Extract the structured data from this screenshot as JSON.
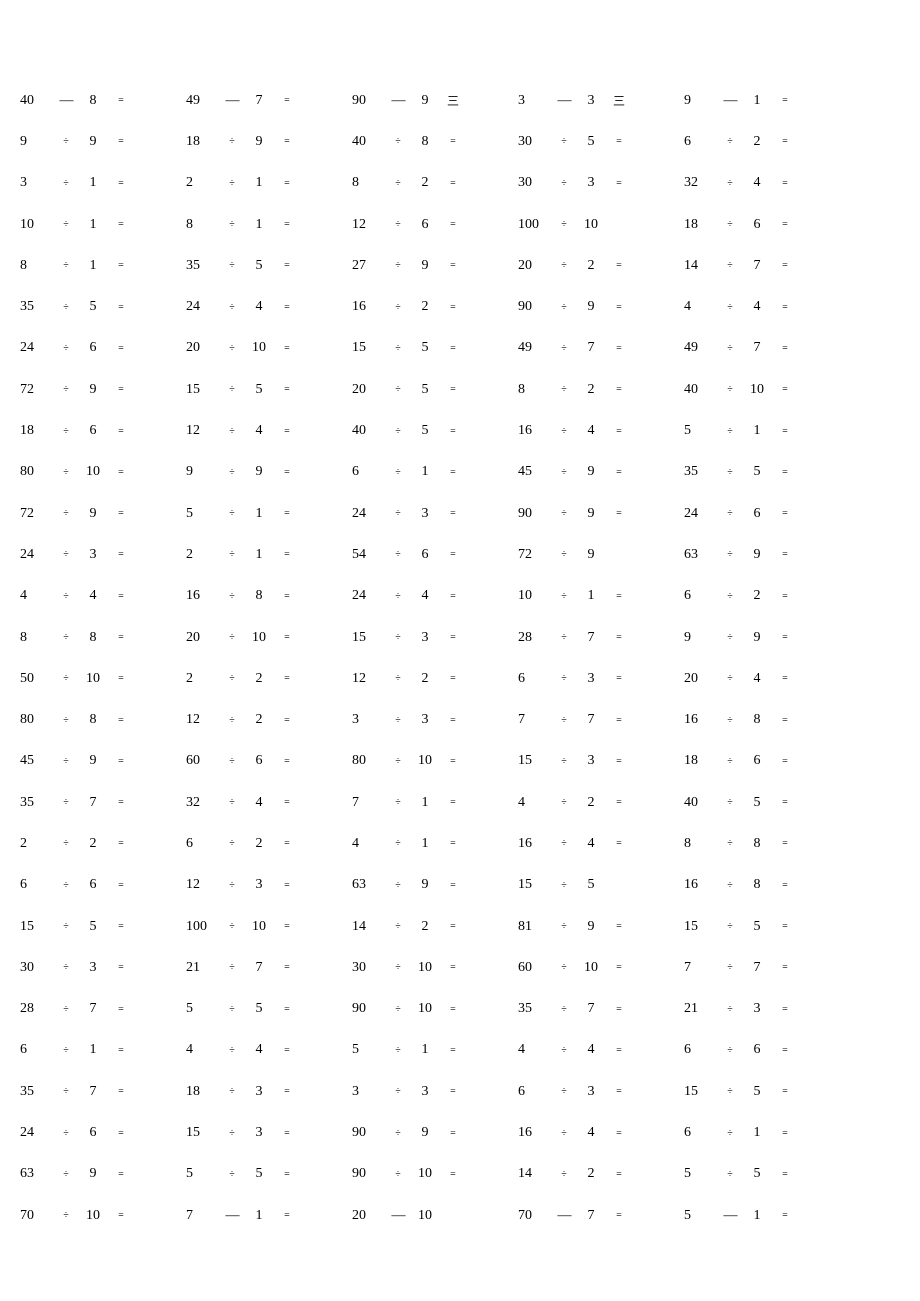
{
  "operator_glyph": "÷",
  "equals_glyph": "=",
  "dash_glyph": "—",
  "triple_glyph": "三",
  "rows": [
    [
      {
        "a": "40",
        "op": "—",
        "b": "8",
        "eq": "="
      },
      {
        "a": "49",
        "op": "—",
        "b": "7",
        "eq": "="
      },
      {
        "a": "90",
        "op": "—",
        "b": "9",
        "eq": "三"
      },
      {
        "a": "3",
        "op": "—",
        "b": "3",
        "eq": "三"
      },
      {
        "a": "9",
        "op": "—",
        "b": "1",
        "eq": "="
      }
    ],
    [
      {
        "a": "9",
        "op": "÷",
        "b": "9",
        "eq": "="
      },
      {
        "a": "18",
        "op": "÷",
        "b": "9",
        "eq": "="
      },
      {
        "a": "40",
        "op": "÷",
        "b": "8",
        "eq": "="
      },
      {
        "a": "30",
        "op": "÷",
        "b": "5",
        "eq": "="
      },
      {
        "a": "6",
        "op": "÷",
        "b": "2",
        "eq": "="
      }
    ],
    [
      {
        "a": "3",
        "op": "÷",
        "b": "1",
        "eq": "="
      },
      {
        "a": "2",
        "op": "÷",
        "b": "1",
        "eq": "="
      },
      {
        "a": "8",
        "op": "÷",
        "b": "2",
        "eq": "="
      },
      {
        "a": "30",
        "op": "÷",
        "b": "3",
        "eq": "="
      },
      {
        "a": "32",
        "op": "÷",
        "b": "4",
        "eq": "="
      }
    ],
    [
      {
        "a": "10",
        "op": "÷",
        "b": "1",
        "eq": "="
      },
      {
        "a": "8",
        "op": "÷",
        "b": "1",
        "eq": "="
      },
      {
        "a": "12",
        "op": "÷",
        "b": "6",
        "eq": "="
      },
      {
        "a": "100",
        "op": "÷",
        "b": "10",
        "eq": ""
      },
      {
        "a": "18",
        "op": "÷",
        "b": "6",
        "eq": "="
      }
    ],
    [
      {
        "a": "8",
        "op": "÷",
        "b": "1",
        "eq": "="
      },
      {
        "a": "35",
        "op": "÷",
        "b": "5",
        "eq": "="
      },
      {
        "a": "27",
        "op": "÷",
        "b": "9",
        "eq": "="
      },
      {
        "a": "20",
        "op": "÷",
        "b": "2",
        "eq": "="
      },
      {
        "a": "14",
        "op": "÷",
        "b": "7",
        "eq": "="
      }
    ],
    [
      {
        "a": "35",
        "op": "÷",
        "b": "5",
        "eq": "="
      },
      {
        "a": "24",
        "op": "÷",
        "b": "4",
        "eq": "="
      },
      {
        "a": "16",
        "op": "÷",
        "b": "2",
        "eq": "="
      },
      {
        "a": "90",
        "op": "÷",
        "b": "9",
        "eq": "="
      },
      {
        "a": "4",
        "op": "÷",
        "b": "4",
        "eq": "="
      }
    ],
    [
      {
        "a": "24",
        "op": "÷",
        "b": "6",
        "eq": "="
      },
      {
        "a": "20",
        "op": "÷",
        "b": "10",
        "eq": "="
      },
      {
        "a": "15",
        "op": "÷",
        "b": "5",
        "eq": "="
      },
      {
        "a": "49",
        "op": "÷",
        "b": "7",
        "eq": "="
      },
      {
        "a": "49",
        "op": "÷",
        "b": "7",
        "eq": "="
      }
    ],
    [
      {
        "a": "72",
        "op": "÷",
        "b": "9",
        "eq": "="
      },
      {
        "a": "15",
        "op": "÷",
        "b": "5",
        "eq": "="
      },
      {
        "a": "20",
        "op": "÷",
        "b": "5",
        "eq": "="
      },
      {
        "a": "8",
        "op": "÷",
        "b": "2",
        "eq": "="
      },
      {
        "a": "40",
        "op": "÷",
        "b": "10",
        "eq": "="
      }
    ],
    [
      {
        "a": "18",
        "op": "÷",
        "b": "6",
        "eq": "="
      },
      {
        "a": "12",
        "op": "÷",
        "b": "4",
        "eq": "="
      },
      {
        "a": "40",
        "op": "÷",
        "b": "5",
        "eq": "="
      },
      {
        "a": "16",
        "op": "÷",
        "b": "4",
        "eq": "="
      },
      {
        "a": "5",
        "op": "÷",
        "b": "1",
        "eq": "="
      }
    ],
    [
      {
        "a": "80",
        "op": "÷",
        "b": "10",
        "eq": "="
      },
      {
        "a": "9",
        "op": "÷",
        "b": "9",
        "eq": "="
      },
      {
        "a": "6",
        "op": "÷",
        "b": "1",
        "eq": "="
      },
      {
        "a": "45",
        "op": "÷",
        "b": "9",
        "eq": "="
      },
      {
        "a": "35",
        "op": "÷",
        "b": "5",
        "eq": "="
      }
    ],
    [
      {
        "a": "72",
        "op": "÷",
        "b": "9",
        "eq": "="
      },
      {
        "a": "5",
        "op": "÷",
        "b": "1",
        "eq": "="
      },
      {
        "a": "24",
        "op": "÷",
        "b": "3",
        "eq": "="
      },
      {
        "a": "90",
        "op": "÷",
        "b": "9",
        "eq": "="
      },
      {
        "a": "24",
        "op": "÷",
        "b": "6",
        "eq": "="
      }
    ],
    [
      {
        "a": "24",
        "op": "÷",
        "b": "3",
        "eq": "="
      },
      {
        "a": "2",
        "op": "÷",
        "b": "1",
        "eq": "="
      },
      {
        "a": "54",
        "op": "÷",
        "b": "6",
        "eq": "="
      },
      {
        "a": "72",
        "op": "÷",
        "b": "9",
        "eq": ""
      },
      {
        "a": "63",
        "op": "÷",
        "b": "9",
        "eq": "="
      }
    ],
    [
      {
        "a": "4",
        "op": "÷",
        "b": "4",
        "eq": "="
      },
      {
        "a": "16",
        "op": "÷",
        "b": "8",
        "eq": "="
      },
      {
        "a": "24",
        "op": "÷",
        "b": "4",
        "eq": "="
      },
      {
        "a": "10",
        "op": "÷",
        "b": "1",
        "eq": "="
      },
      {
        "a": "6",
        "op": "÷",
        "b": "2",
        "eq": "="
      }
    ],
    [
      {
        "a": "8",
        "op": "÷",
        "b": "8",
        "eq": "="
      },
      {
        "a": "20",
        "op": "÷",
        "b": "10",
        "eq": "="
      },
      {
        "a": "15",
        "op": "÷",
        "b": "3",
        "eq": "="
      },
      {
        "a": "28",
        "op": "÷",
        "b": "7",
        "eq": "="
      },
      {
        "a": "9",
        "op": "÷",
        "b": "9",
        "eq": "="
      }
    ],
    [
      {
        "a": "50",
        "op": "÷",
        "b": "10",
        "eq": "="
      },
      {
        "a": "2",
        "op": "÷",
        "b": "2",
        "eq": "="
      },
      {
        "a": "12",
        "op": "÷",
        "b": "2",
        "eq": "="
      },
      {
        "a": "6",
        "op": "÷",
        "b": "3",
        "eq": "="
      },
      {
        "a": "20",
        "op": "÷",
        "b": "4",
        "eq": "="
      }
    ],
    [
      {
        "a": "80",
        "op": "÷",
        "b": "8",
        "eq": "="
      },
      {
        "a": "12",
        "op": "÷",
        "b": "2",
        "eq": "="
      },
      {
        "a": "3",
        "op": "÷",
        "b": "3",
        "eq": "="
      },
      {
        "a": "7",
        "op": "÷",
        "b": "7",
        "eq": "="
      },
      {
        "a": "16",
        "op": "÷",
        "b": "8",
        "eq": "="
      }
    ],
    [
      {
        "a": "45",
        "op": "÷",
        "b": "9",
        "eq": "="
      },
      {
        "a": "60",
        "op": "÷",
        "b": "6",
        "eq": "="
      },
      {
        "a": "80",
        "op": "÷",
        "b": "10",
        "eq": "="
      },
      {
        "a": "15",
        "op": "÷",
        "b": "3",
        "eq": "="
      },
      {
        "a": "18",
        "op": "÷",
        "b": "6",
        "eq": "="
      }
    ],
    [
      {
        "a": "35",
        "op": "÷",
        "b": "7",
        "eq": "="
      },
      {
        "a": "32",
        "op": "÷",
        "b": "4",
        "eq": "="
      },
      {
        "a": "7",
        "op": "÷",
        "b": "1",
        "eq": "="
      },
      {
        "a": "4",
        "op": "÷",
        "b": "2",
        "eq": "="
      },
      {
        "a": "40",
        "op": "÷",
        "b": "5",
        "eq": "="
      }
    ],
    [
      {
        "a": "2",
        "op": "÷",
        "b": "2",
        "eq": "="
      },
      {
        "a": "6",
        "op": "÷",
        "b": "2",
        "eq": "="
      },
      {
        "a": "4",
        "op": "÷",
        "b": "1",
        "eq": "="
      },
      {
        "a": "16",
        "op": "÷",
        "b": "4",
        "eq": "="
      },
      {
        "a": "8",
        "op": "÷",
        "b": "8",
        "eq": "="
      }
    ],
    [
      {
        "a": "6",
        "op": "÷",
        "b": "6",
        "eq": "="
      },
      {
        "a": "12",
        "op": "÷",
        "b": "3",
        "eq": "="
      },
      {
        "a": "63",
        "op": "÷",
        "b": "9",
        "eq": "="
      },
      {
        "a": "15",
        "op": "÷",
        "b": "5",
        "eq": ""
      },
      {
        "a": "16",
        "op": "÷",
        "b": "8",
        "eq": "="
      }
    ],
    [
      {
        "a": "15",
        "op": "÷",
        "b": "5",
        "eq": "="
      },
      {
        "a": "100",
        "op": "÷",
        "b": "10",
        "eq": "="
      },
      {
        "a": "14",
        "op": "÷",
        "b": "2",
        "eq": "="
      },
      {
        "a": "81",
        "op": "÷",
        "b": "9",
        "eq": "="
      },
      {
        "a": "15",
        "op": "÷",
        "b": "5",
        "eq": "="
      }
    ],
    [
      {
        "a": "30",
        "op": "÷",
        "b": "3",
        "eq": "="
      },
      {
        "a": "21",
        "op": "÷",
        "b": "7",
        "eq": "="
      },
      {
        "a": "30",
        "op": "÷",
        "b": "10",
        "eq": "="
      },
      {
        "a": "60",
        "op": "÷",
        "b": "10",
        "eq": "="
      },
      {
        "a": "7",
        "op": "÷",
        "b": "7",
        "eq": "="
      }
    ],
    [
      {
        "a": "28",
        "op": "÷",
        "b": "7",
        "eq": "="
      },
      {
        "a": "5",
        "op": "÷",
        "b": "5",
        "eq": "="
      },
      {
        "a": "90",
        "op": "÷",
        "b": "10",
        "eq": "="
      },
      {
        "a": "35",
        "op": "÷",
        "b": "7",
        "eq": "="
      },
      {
        "a": "21",
        "op": "÷",
        "b": "3",
        "eq": "="
      }
    ],
    [
      {
        "a": "6",
        "op": "÷",
        "b": "1",
        "eq": "="
      },
      {
        "a": "4",
        "op": "÷",
        "b": "4",
        "eq": "="
      },
      {
        "a": "5",
        "op": "÷",
        "b": "1",
        "eq": "="
      },
      {
        "a": "4",
        "op": "÷",
        "b": "4",
        "eq": "="
      },
      {
        "a": "6",
        "op": "÷",
        "b": "6",
        "eq": "="
      }
    ],
    [
      {
        "a": "35",
        "op": "÷",
        "b": "7",
        "eq": "="
      },
      {
        "a": "18",
        "op": "÷",
        "b": "3",
        "eq": "="
      },
      {
        "a": "3",
        "op": "÷",
        "b": "3",
        "eq": "="
      },
      {
        "a": "6",
        "op": "÷",
        "b": "3",
        "eq": "="
      },
      {
        "a": "15",
        "op": "÷",
        "b": "5",
        "eq": "="
      }
    ],
    [
      {
        "a": "24",
        "op": "÷",
        "b": "6",
        "eq": "="
      },
      {
        "a": "15",
        "op": "÷",
        "b": "3",
        "eq": "="
      },
      {
        "a": "90",
        "op": "÷",
        "b": "9",
        "eq": "="
      },
      {
        "a": "16",
        "op": "÷",
        "b": "4",
        "eq": "="
      },
      {
        "a": "6",
        "op": "÷",
        "b": "1",
        "eq": "="
      }
    ],
    [
      {
        "a": "63",
        "op": "÷",
        "b": "9",
        "eq": "="
      },
      {
        "a": "5",
        "op": "÷",
        "b": "5",
        "eq": "="
      },
      {
        "a": "90",
        "op": "÷",
        "b": "10",
        "eq": "="
      },
      {
        "a": "14",
        "op": "÷",
        "b": "2",
        "eq": "="
      },
      {
        "a": "5",
        "op": "÷",
        "b": "5",
        "eq": "="
      }
    ],
    [
      {
        "a": "70",
        "op": "÷",
        "b": "10",
        "eq": "="
      },
      {
        "a": "7",
        "op": "—",
        "b": "1",
        "eq": "="
      },
      {
        "a": "20",
        "op": "—",
        "b": "10",
        "eq": ""
      },
      {
        "a": "70",
        "op": "—",
        "b": "7",
        "eq": "="
      },
      {
        "a": "5",
        "op": "—",
        "b": "1",
        "eq": "="
      }
    ]
  ]
}
